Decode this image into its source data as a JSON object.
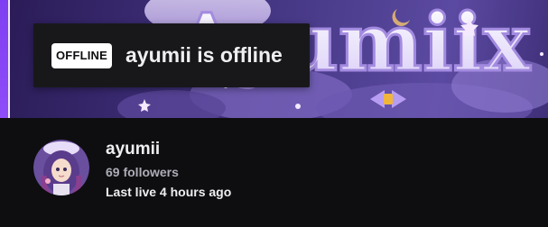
{
  "offline_card": {
    "badge": "OFFLINE",
    "message": "ayumii is offline"
  },
  "banner": {
    "artwork_text": "Ayumiix",
    "icon": "channel-banner-artwork"
  },
  "channel": {
    "name": "ayumii",
    "followers": "69 followers",
    "last_live": "Last live 4 hours ago",
    "avatar_icon": "anime-avatar"
  },
  "colors": {
    "background": "#0e0e10",
    "card": "#18181b",
    "text_primary": "#efeff1",
    "text_secondary": "#adadb8",
    "accent_purple": "#9147ff"
  }
}
